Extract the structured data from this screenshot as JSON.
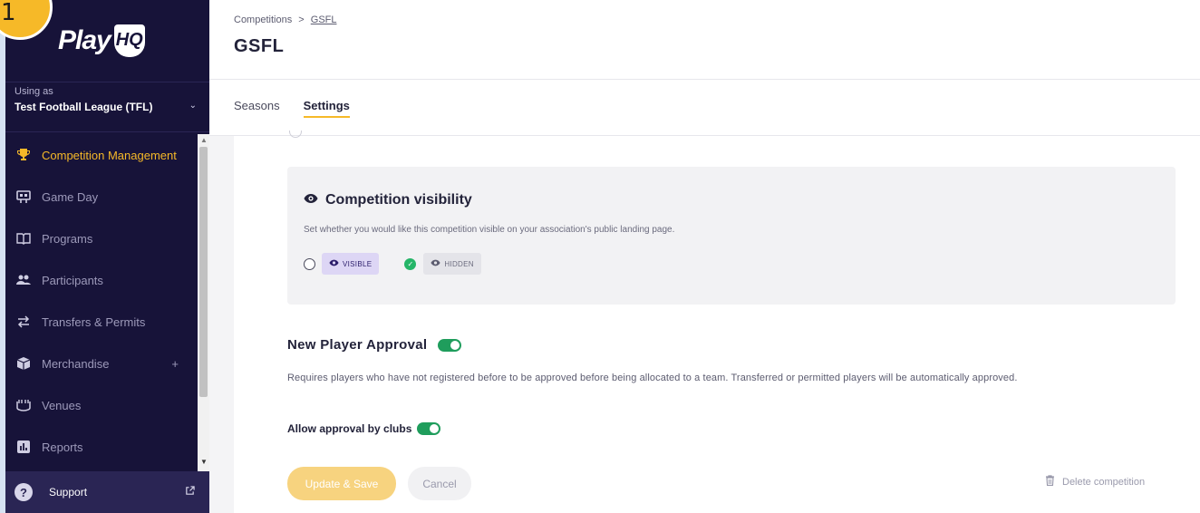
{
  "overlay": {
    "step_number": "1"
  },
  "sidebar": {
    "logo_text": "Play",
    "logo_mark": "HQ",
    "using_as_label": "Using as",
    "organisation": "Test Football League (TFL)",
    "nav_items": [
      {
        "label": "Competition Management",
        "icon": "trophy-icon",
        "active": true
      },
      {
        "label": "Game Day",
        "icon": "scoreboard-icon"
      },
      {
        "label": "Programs",
        "icon": "book-icon"
      },
      {
        "label": "Participants",
        "icon": "people-icon"
      },
      {
        "label": "Transfers & Permits",
        "icon": "transfer-arrows-icon"
      },
      {
        "label": "Merchandise",
        "icon": "box-icon",
        "suffix": "+"
      },
      {
        "label": "Venues",
        "icon": "stadium-icon"
      },
      {
        "label": "Reports",
        "icon": "chart-icon"
      }
    ],
    "support_label": "Support"
  },
  "header": {
    "breadcrumb": [
      "Competitions",
      "GSFL"
    ],
    "breadcrumb_separator": ">",
    "title": "GSFL"
  },
  "tabs": [
    {
      "label": "Seasons",
      "active": false
    },
    {
      "label": "Settings",
      "active": true
    }
  ],
  "visibility": {
    "title": "Competition visibility",
    "description": "Set whether you would like this competition visible on your association's public landing page.",
    "options": [
      {
        "label": "VISIBLE",
        "selected": false
      },
      {
        "label": "HIDDEN",
        "selected": true
      }
    ]
  },
  "approval": {
    "title": "New Player Approval",
    "enabled": true,
    "description": "Requires players who have not registered before to be approved before being allocated to a team. Transferred or permitted players will be automatically approved.",
    "clubs_label": "Allow approval by clubs",
    "clubs_enabled": true
  },
  "actions": {
    "save_label": "Update & Save",
    "cancel_label": "Cancel",
    "delete_label": "Delete competition"
  },
  "colors": {
    "sidebar_bg": "#171339",
    "accent": "#f6b928",
    "toggle_on": "#1f9d5c",
    "check": "#25b568",
    "visible_pill": "#ddd6f5"
  }
}
